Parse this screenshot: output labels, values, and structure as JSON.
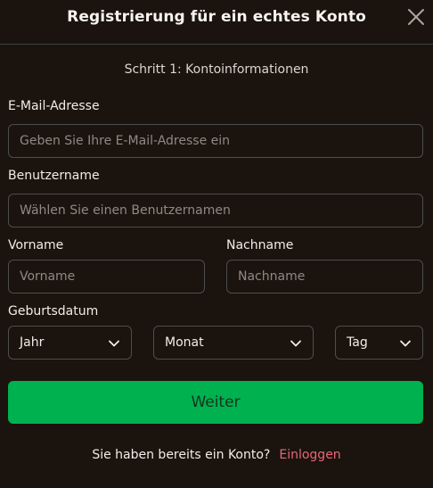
{
  "dialog": {
    "title": "Registrierung für ein echtes Konto",
    "step": "Schritt 1: Kontoinformationen"
  },
  "form": {
    "email": {
      "label": "E-Mail-Adresse",
      "placeholder": "Geben Sie Ihre E-Mail-Adresse ein",
      "value": ""
    },
    "username": {
      "label": "Benutzername",
      "placeholder": "Wählen Sie einen Benutzernamen",
      "value": ""
    },
    "firstname": {
      "label": "Vorname",
      "placeholder": "Vorname",
      "value": ""
    },
    "lastname": {
      "label": "Nachname",
      "placeholder": "Nachname",
      "value": ""
    },
    "birthdate": {
      "label": "Geburtsdatum",
      "year": "Jahr",
      "month": "Monat",
      "day": "Tag"
    }
  },
  "actions": {
    "continue_label": "Weiter",
    "have_account": "Sie haben bereits ein Konto?",
    "login_label": "Einloggen"
  },
  "colors": {
    "background": "#1b130d",
    "accent": "#00b14f",
    "link": "#e8677a"
  },
  "icons": {
    "close": "close-icon",
    "dropdown": "chevron-down-icon"
  }
}
